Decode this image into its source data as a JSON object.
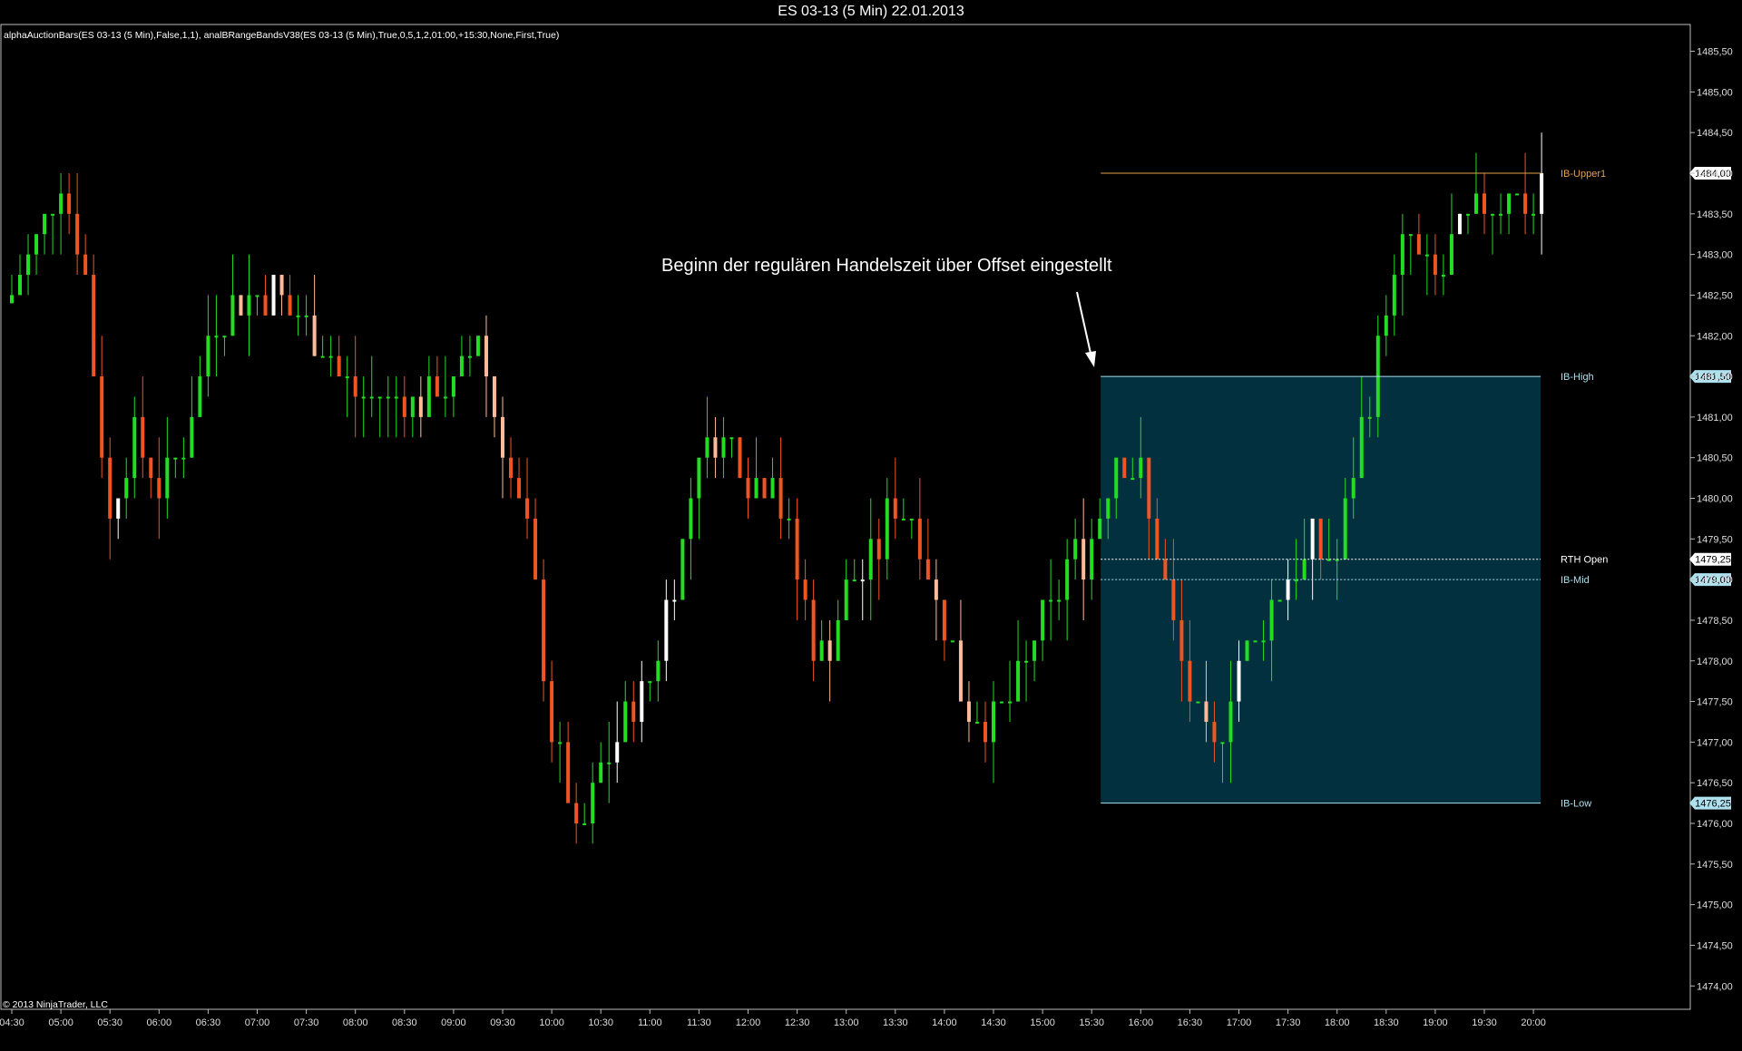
{
  "window": {
    "title": "ES 03-13 (5 Min)  22.01.2013"
  },
  "indicator_label": "alphaAuctionBars(ES 03-13 (5 Min),False,1,1), analBRangeBandsV38(ES 03-13 (5 Min),True,0,5,1,2,01:00,+15:30,None,First,True)",
  "copyright": "© 2013 NinjaTrader, LLC",
  "annotation": "Beginn der regulären Handelszeit über Offset eingestellt",
  "colors": {
    "background": "#000000",
    "up_bar": "#22dd22",
    "down_bar": "#ee5522",
    "up_bar_light": "#ffffff",
    "down_bar_light": "#ffbb99",
    "ib_fill": "#02303f",
    "ib_upper_label": "#e6a04a",
    "axis_text": "#dddddd"
  },
  "chart_data": {
    "type": "candlestick",
    "title": "ES 03-13 (5 Min)  22.01.2013",
    "instrument": "ES 03-13",
    "timeframe": "5 Min",
    "date": "22.01.2013",
    "ylim": [
      1473.75,
      1486.0
    ],
    "y_ticks": [
      "1474,00",
      "1474,50",
      "1475,00",
      "1475,50",
      "1476,00",
      "1476,50",
      "1477,00",
      "1477,50",
      "1478,00",
      "1478,50",
      "1479,00",
      "1479,50",
      "1480,00",
      "1480,50",
      "1481,00",
      "1481,50",
      "1482,00",
      "1482,50",
      "1483,00",
      "1483,50",
      "1484,00",
      "1484,50",
      "1485,00",
      "1485,50"
    ],
    "x_ticks": [
      "04:30",
      "05:00",
      "05:30",
      "06:00",
      "06:30",
      "07:00",
      "07:30",
      "08:00",
      "08:30",
      "09:00",
      "09:30",
      "10:00",
      "10:30",
      "11:00",
      "11:30",
      "12:00",
      "12:30",
      "13:00",
      "13:30",
      "14:00",
      "14:30",
      "15:00",
      "15:30",
      "16:00",
      "16:30",
      "17:00",
      "17:30",
      "18:00",
      "18:30",
      "19:00",
      "19:30",
      "20:00"
    ],
    "levels": [
      {
        "name": "IB-Upper1",
        "value": 1484.0,
        "price_label": "1484,00",
        "color": "#e6a04a"
      },
      {
        "name": "IB-High",
        "value": 1481.5,
        "price_label": "1481,50",
        "color": "#aee0ee"
      },
      {
        "name": "RTH Open",
        "value": 1479.25,
        "price_label": "1479,25",
        "color": "#ffffff"
      },
      {
        "name": "IB-Mid",
        "value": 1479.0,
        "price_label": "1479,00",
        "color": "#aee0ee"
      },
      {
        "name": "IB-Low",
        "value": 1476.25,
        "price_label": "1476,25",
        "color": "#aee0ee"
      }
    ],
    "ib_range": {
      "start": "15:30",
      "end": "20:00",
      "high": 1481.5,
      "low": 1476.25
    },
    "anchors": [
      [
        "04:30",
        1482.4
      ],
      [
        "05:00",
        1484.0
      ],
      [
        "05:15",
        1482.6
      ],
      [
        "05:30",
        1479.8
      ],
      [
        "05:45",
        1480.8
      ],
      [
        "06:00",
        1480.2
      ],
      [
        "06:15",
        1480.6
      ],
      [
        "06:30",
        1482.0
      ],
      [
        "07:00",
        1482.6
      ],
      [
        "07:30",
        1482.2
      ],
      [
        "08:00",
        1481.2
      ],
      [
        "08:30",
        1481.2
      ],
      [
        "09:00",
        1481.4
      ],
      [
        "09:15",
        1482.0
      ],
      [
        "09:30",
        1480.6
      ],
      [
        "09:45",
        1479.6
      ],
      [
        "10:00",
        1477.2
      ],
      [
        "10:15",
        1475.8
      ],
      [
        "10:30",
        1476.6
      ],
      [
        "10:45",
        1477.4
      ],
      [
        "11:00",
        1477.8
      ],
      [
        "11:15",
        1479.0
      ],
      [
        "11:30",
        1480.6
      ],
      [
        "11:45",
        1480.8
      ],
      [
        "12:00",
        1480.2
      ],
      [
        "12:15",
        1480.4
      ],
      [
        "12:30",
        1479.0
      ],
      [
        "12:45",
        1478.0
      ],
      [
        "13:00",
        1478.8
      ],
      [
        "13:15",
        1479.2
      ],
      [
        "13:30",
        1480.0
      ],
      [
        "13:45",
        1479.6
      ],
      [
        "14:00",
        1478.4
      ],
      [
        "14:15",
        1477.4
      ],
      [
        "14:30",
        1477.2
      ],
      [
        "14:45",
        1477.8
      ],
      [
        "15:00",
        1478.4
      ],
      [
        "15:15",
        1479.2
      ],
      [
        "15:30",
        1479.4
      ],
      [
        "15:45",
        1480.6
      ],
      [
        "16:00",
        1480.2
      ],
      [
        "16:15",
        1478.8
      ],
      [
        "16:30",
        1477.6
      ],
      [
        "16:45",
        1476.8
      ],
      [
        "17:00",
        1478.0
      ],
      [
        "17:15",
        1478.4
      ],
      [
        "17:30",
        1479.0
      ],
      [
        "17:45",
        1479.4
      ],
      [
        "18:00",
        1479.2
      ],
      [
        "18:15",
        1480.8
      ],
      [
        "18:30",
        1482.4
      ],
      [
        "18:45",
        1483.2
      ],
      [
        "19:00",
        1482.6
      ],
      [
        "19:15",
        1483.2
      ],
      [
        "19:30",
        1483.6
      ],
      [
        "19:45",
        1483.8
      ],
      [
        "20:00",
        1483.6
      ],
      [
        "20:05",
        1484.0
      ]
    ]
  }
}
